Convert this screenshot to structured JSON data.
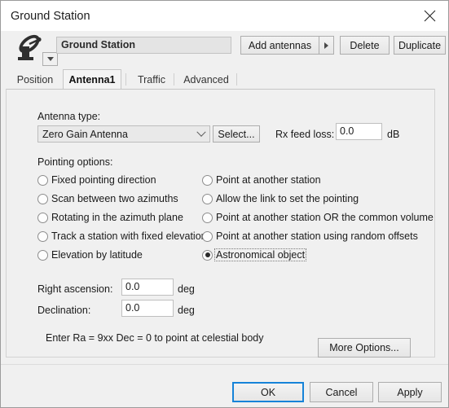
{
  "window": {
    "title": "Ground Station",
    "close_icon": "close-icon"
  },
  "toolbar": {
    "dish_icon": "satellite-dish-icon",
    "dish_dropdown_icon": "caret-down-icon",
    "name_value": "Ground Station",
    "add_antennas_label": "Add antennas",
    "add_antennas_arrow_icon": "caret-right-icon",
    "delete_label": "Delete",
    "duplicate_label": "Duplicate"
  },
  "tabs": [
    {
      "label": "Position",
      "selected": false
    },
    {
      "label": "Antenna1",
      "selected": true
    },
    {
      "label": "Traffic",
      "selected": false
    },
    {
      "label": "Advanced",
      "selected": false
    }
  ],
  "panel": {
    "antenna_type_label": "Antenna type:",
    "antenna_type_value": "Zero Gain Antenna",
    "antenna_type_arrow_icon": "chevron-down-icon",
    "select_label": "Select...",
    "rx_feed_loss_label": "Rx feed loss:",
    "rx_feed_loss_value": "0.0",
    "rx_feed_loss_unit": "dB",
    "pointing_options_label": "Pointing options:",
    "pointing_options_left": [
      {
        "label": "Fixed pointing direction",
        "checked": false
      },
      {
        "label": "Scan between two azimuths",
        "checked": false
      },
      {
        "label": "Rotating in the azimuth plane",
        "checked": false
      },
      {
        "label": "Track a station with fixed elevation",
        "checked": false
      },
      {
        "label": "Elevation by latitude",
        "checked": false
      }
    ],
    "pointing_options_right": [
      {
        "label": "Point at another station",
        "checked": false
      },
      {
        "label": "Allow the link to set the pointing",
        "checked": false
      },
      {
        "label": "Point at another station OR the common volume",
        "checked": false
      },
      {
        "label": "Point at another station using random offsets",
        "checked": false
      },
      {
        "label": "Astronomical object",
        "checked": true
      }
    ],
    "right_ascension_label": "Right ascension:",
    "right_ascension_value": "0.0",
    "right_ascension_unit": "deg",
    "declination_label": "Declination:",
    "declination_value": "0.0",
    "declination_unit": "deg",
    "hint_text": "Enter Ra = 9xx Dec = 0 to point at celestial body",
    "more_options_label": "More Options..."
  },
  "footer": {
    "ok_label": "OK",
    "cancel_label": "Cancel",
    "apply_label": "Apply"
  },
  "colors": {
    "focus_blue": "#1683d8",
    "window_bg": "#f0f0f0",
    "titlebar_bg": "#ffffff"
  }
}
